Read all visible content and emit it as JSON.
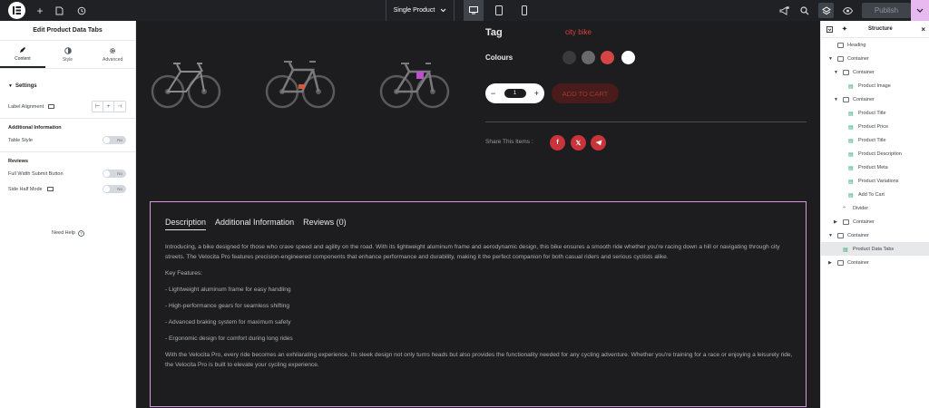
{
  "topbar": {
    "document_selector": "Single Product",
    "publish_label": "Publish"
  },
  "left_panel": {
    "title": "Edit Product Data Tabs",
    "tabs": [
      {
        "label": "Content",
        "icon": "pencil-icon"
      },
      {
        "label": "Style",
        "icon": "half-circle-icon"
      },
      {
        "label": "Advanced",
        "icon": "gear-icon"
      }
    ],
    "settings_heading": "Settings",
    "label_alignment": "Label Alignment",
    "additional_information_heading": "Additional Information",
    "table_style": "Table Style",
    "reviews_heading": "Reviews",
    "full_width_submit": "Full Width Submit Button",
    "side_half_mode": "Side Half Mode",
    "toggle_off_text": "No",
    "need_help": "Need Help"
  },
  "product": {
    "tag_label": "Tag",
    "tag_value": "city bike",
    "colours_label": "Colours",
    "colours": [
      "#3a3a3c",
      "#6a6a6c",
      "#d64545",
      "#ffffff"
    ],
    "quantity": "1",
    "add_to_cart": "ADD TO CART",
    "share_label": "Share This Items :",
    "share_icons": [
      "facebook-icon",
      "x-icon",
      "telegram-icon"
    ]
  },
  "data_tabs": {
    "tabs": [
      "Description",
      "Additional Information",
      "Reviews (0)"
    ],
    "intro": "Introducing, a bike designed for those who crave speed and agility on the road. With its lightweight aluminum frame and aerodynamic design, this bike ensures a smooth ride whether you're racing down a hill or navigating through city streets. The Velocita Pro features precision-engineered components that enhance performance and durability, making it the perfect companion for both casual riders and serious cyclists alike.",
    "features_heading": "Key Features:",
    "features": [
      "- Lightweight aluminum frame for easy handling",
      "- High-performance gears for seamless shifting",
      "- Advanced braking system for maximum safety",
      "- Ergonomic design for comfort during long rides"
    ],
    "outro": "With the Velocita Pro, every ride becomes an exhilarating experience. Its sleek design not only turns heads but also provides the functionality needed for any cycling adventure. Whether you're training for a race or enjoying a leisurely ride, the Velocita Pro is built to elevate your cycling experience."
  },
  "structure": {
    "title": "Structure",
    "items": [
      {
        "label": "Heading",
        "depth": 0,
        "caret": "",
        "type": "container"
      },
      {
        "label": "Container",
        "depth": 0,
        "caret": "down",
        "type": "container"
      },
      {
        "label": "Container",
        "depth": 1,
        "caret": "down",
        "type": "container"
      },
      {
        "label": "Product Image",
        "depth": 2,
        "caret": "",
        "type": "widget"
      },
      {
        "label": "Container",
        "depth": 1,
        "caret": "down",
        "type": "container"
      },
      {
        "label": "Product Title",
        "depth": 2,
        "caret": "",
        "type": "widget"
      },
      {
        "label": "Product Price",
        "depth": 2,
        "caret": "",
        "type": "widget"
      },
      {
        "label": "Product Title",
        "depth": 2,
        "caret": "",
        "type": "widget"
      },
      {
        "label": "Product Description",
        "depth": 2,
        "caret": "",
        "type": "widget"
      },
      {
        "label": "Product Meta",
        "depth": 2,
        "caret": "",
        "type": "widget"
      },
      {
        "label": "Product Variations",
        "depth": 2,
        "caret": "",
        "type": "widget"
      },
      {
        "label": "Add To Cart",
        "depth": 2,
        "caret": "",
        "type": "widget"
      },
      {
        "label": "Divider",
        "depth": 1,
        "caret": "",
        "type": "divider"
      },
      {
        "label": "Container",
        "depth": 1,
        "caret": "right",
        "type": "container"
      },
      {
        "label": "Container",
        "depth": 0,
        "caret": "down",
        "type": "container"
      },
      {
        "label": "Product Data Tabs",
        "depth": 1,
        "caret": "",
        "type": "widget",
        "selected": true
      },
      {
        "label": "Container",
        "depth": 0,
        "caret": "right",
        "type": "container"
      }
    ]
  }
}
